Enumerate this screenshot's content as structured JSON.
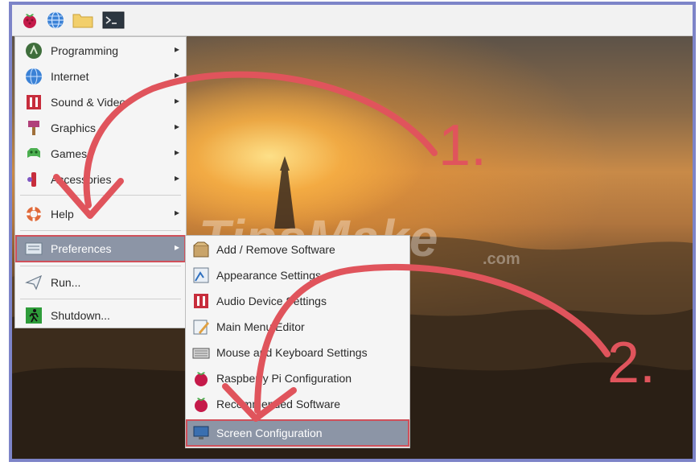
{
  "taskbar": {
    "icons": [
      "raspberry-menu-icon",
      "globe-icon",
      "folder-icon",
      "terminal-icon"
    ]
  },
  "menu": {
    "items": [
      {
        "label": "Programming",
        "icon": "programming-icon",
        "submenu": true
      },
      {
        "label": "Internet",
        "icon": "globe-icon",
        "submenu": true
      },
      {
        "label": "Sound & Video",
        "icon": "sound-video-icon",
        "submenu": true
      },
      {
        "label": "Graphics",
        "icon": "paintbrush-icon",
        "submenu": true
      },
      {
        "label": "Games",
        "icon": "games-icon",
        "submenu": true
      },
      {
        "label": "Accessories",
        "icon": "accessories-icon",
        "submenu": true
      },
      {
        "label": "Help",
        "icon": "lifebuoy-icon",
        "submenu": true
      },
      {
        "label": "Preferences",
        "icon": "preferences-icon",
        "submenu": true,
        "selected": true
      },
      {
        "label": "Run...",
        "icon": "paper-plane-icon",
        "submenu": false
      },
      {
        "label": "Shutdown...",
        "icon": "running-man-icon",
        "submenu": false
      }
    ]
  },
  "submenu": {
    "items": [
      {
        "label": "Add / Remove Software",
        "icon": "package-icon"
      },
      {
        "label": "Appearance Settings",
        "icon": "appearance-icon"
      },
      {
        "label": "Audio Device Settings",
        "icon": "audio-icon"
      },
      {
        "label": "Main Menu Editor",
        "icon": "menu-editor-icon"
      },
      {
        "label": "Mouse and Keyboard Settings",
        "icon": "keyboard-icon"
      },
      {
        "label": "Raspberry Pi Configuration",
        "icon": "raspberry-icon"
      },
      {
        "label": "Recommended Software",
        "icon": "raspberry-icon"
      },
      {
        "label": "Screen Configuration",
        "icon": "monitor-icon",
        "selected": true
      }
    ]
  },
  "annotations": {
    "step1": "1.",
    "step2": "2."
  },
  "watermark": {
    "text": "TipsMake",
    "suffix": ".com"
  },
  "colors": {
    "annotation": "#e0545c",
    "selected_bg": "#8c95a6",
    "frame_border": "#7d84c8"
  }
}
